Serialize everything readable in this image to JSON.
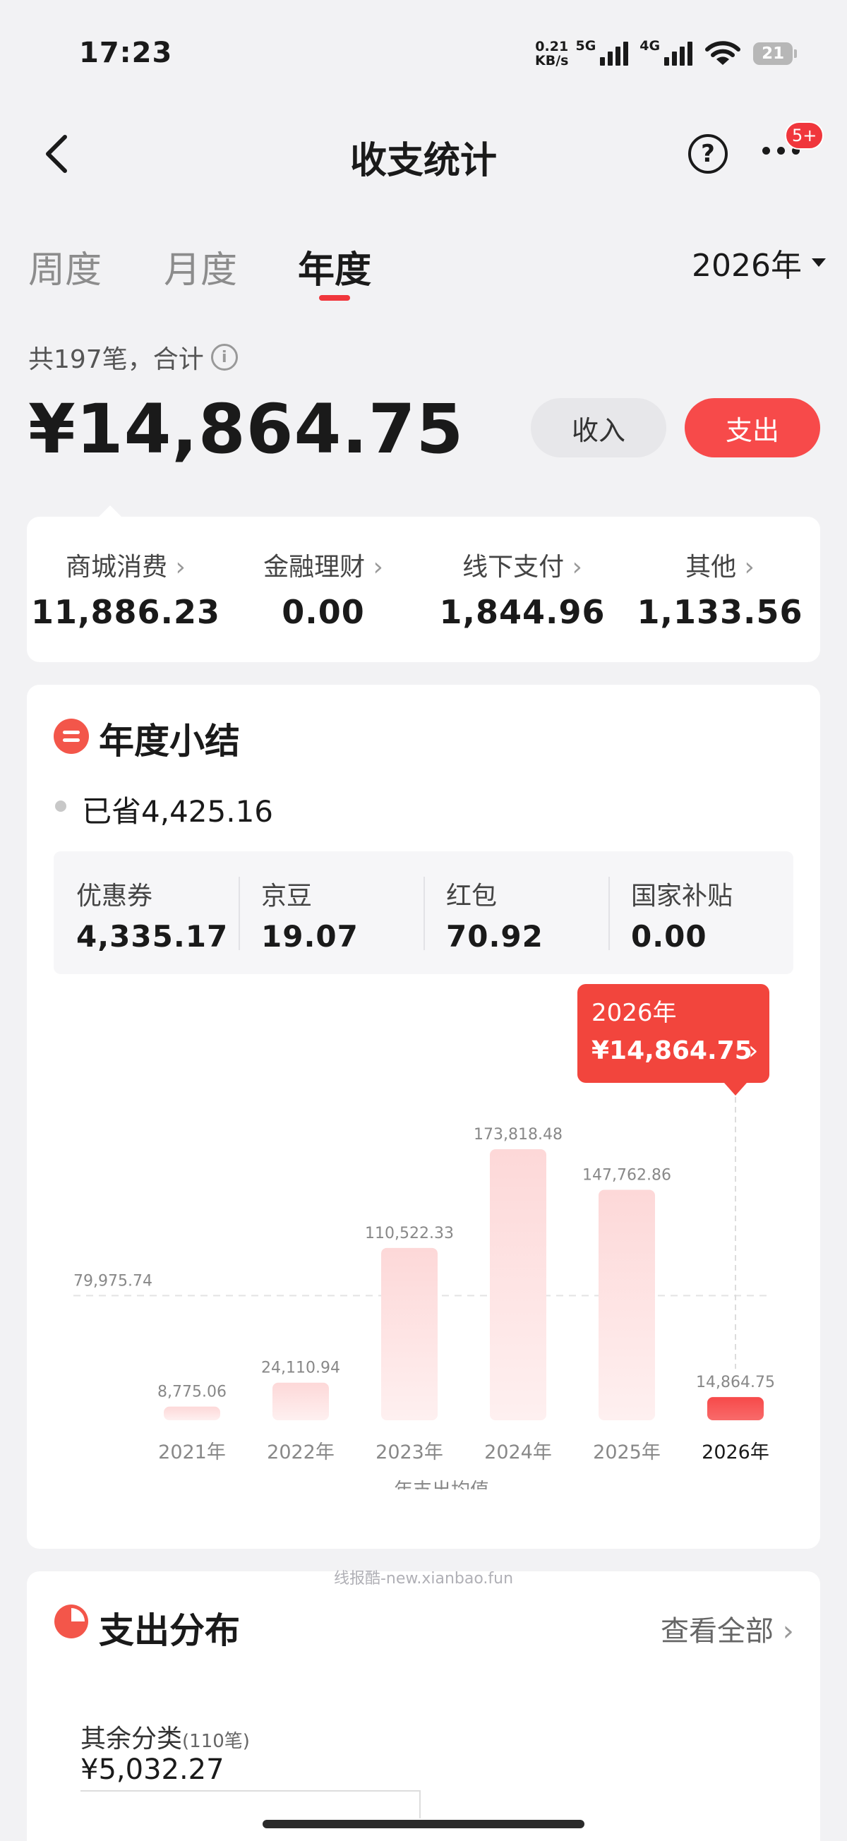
{
  "status_bar": {
    "time": "17:23",
    "net_speed_value": "0.21",
    "net_speed_unit": "KB/s",
    "network_1": "5G",
    "network_2": "4G",
    "battery": "21"
  },
  "header": {
    "title": "收支统计",
    "badge": "5+",
    "help_symbol": "?"
  },
  "tabs": [
    {
      "label": "周度",
      "active": false
    },
    {
      "label": "月度",
      "active": false
    },
    {
      "label": "年度",
      "active": true
    }
  ],
  "year_selector": "2026年",
  "summary": {
    "count_text": "共197笔，合计",
    "info_symbol": "i",
    "total": "¥14,864.75",
    "income_label": "收入",
    "expense_label": "支出"
  },
  "categories": [
    {
      "label": "商城消费",
      "value": "11,886.23"
    },
    {
      "label": "金融理财",
      "value": "0.00"
    },
    {
      "label": "线下支付",
      "value": "1,844.96"
    },
    {
      "label": "其他",
      "value": "1,133.56"
    }
  ],
  "annual_summary": {
    "title": "年度小结",
    "saved_text": "已省4,425.16",
    "savings": [
      {
        "label": "优惠券",
        "value": "4,335.17"
      },
      {
        "label": "京豆",
        "value": "19.07"
      },
      {
        "label": "红包",
        "value": "70.92"
      },
      {
        "label": "国家补贴",
        "value": "0.00"
      }
    ]
  },
  "chart_data": {
    "type": "bar",
    "categories": [
      "2021年",
      "2022年",
      "2023年",
      "2024年",
      "2025年",
      "2026年"
    ],
    "values": [
      8775.06,
      24110.94,
      110522.33,
      173818.48,
      147762.86,
      14864.75
    ],
    "value_labels": [
      "8,775.06",
      "24,110.94",
      "110,522.33",
      "173,818.48",
      "147,762.86",
      "14,864.75"
    ],
    "average": 79975.74,
    "average_label": "79,975.74",
    "legend": "年支出均值",
    "selected_index": 5,
    "tooltip_title": "2026年",
    "tooltip_value": "¥14,864.75",
    "ylim": [
      0,
      173818.48
    ],
    "colors": {
      "bar": "#fde3e3",
      "selected": "#f74a4a",
      "tooltip": "#f2453d"
    }
  },
  "distribution": {
    "title": "支出分布",
    "view_all": "查看全部",
    "other_label": "其余分类",
    "other_count": "(110笔)",
    "other_amount": "¥5,032.27"
  },
  "watermark": "线报酷-new.xianbao.fun",
  "icons": {
    "chevron": "›"
  }
}
